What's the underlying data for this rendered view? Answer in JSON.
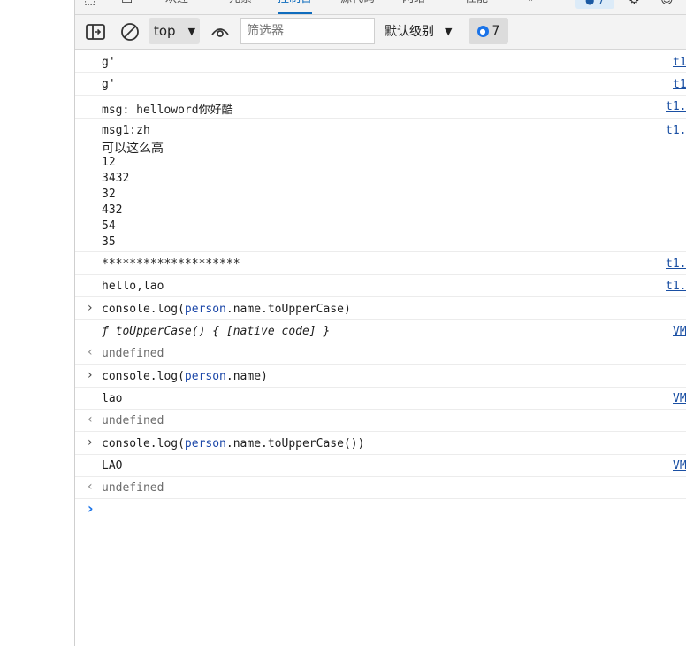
{
  "tabs": {
    "t1": "欢迎",
    "t2": "元素",
    "t3": "控制台",
    "t4": "源代码",
    "t5": "网络",
    "t6": "性能",
    "more": "»",
    "badge": "7"
  },
  "toolbar": {
    "context": "top",
    "filter_placeholder": "筛选器",
    "levels": "默认级别",
    "issues_count": "7"
  },
  "messages": {
    "m1": {
      "text": "g'",
      "src": "t1"
    },
    "m2": {
      "text": "g'",
      "src": "t1"
    },
    "m3": {
      "text": "msg: helloword你好酷",
      "src": "t1."
    },
    "m4": {
      "lines": [
        "msg1:zh",
        "可以这么高",
        "12",
        "3432",
        "32",
        "432",
        "54",
        "35"
      ],
      "src": "t1."
    },
    "m5": {
      "text": "********************",
      "src": "t1."
    },
    "m6": {
      "text": "hello,lao",
      "src": "t1."
    },
    "c1": {
      "pre": "console.log(",
      "v": "person",
      "post": ".name.toUpperCase)"
    },
    "o1": {
      "text": "ƒ toUpperCase() { [native code] }",
      "src": "VM"
    },
    "r1": {
      "text": "undefined"
    },
    "c2": {
      "pre": "console.log(",
      "v": "person",
      "post": ".name)"
    },
    "o2": {
      "text": "lao",
      "src": "VM"
    },
    "r2": {
      "text": "undefined"
    },
    "c3": {
      "pre": "console.log(",
      "v": "person",
      "post": ".name.toUpperCase())"
    },
    "o3": {
      "text": "LAO",
      "src": "VM"
    },
    "r3": {
      "text": "undefined"
    }
  },
  "prompt": "›"
}
